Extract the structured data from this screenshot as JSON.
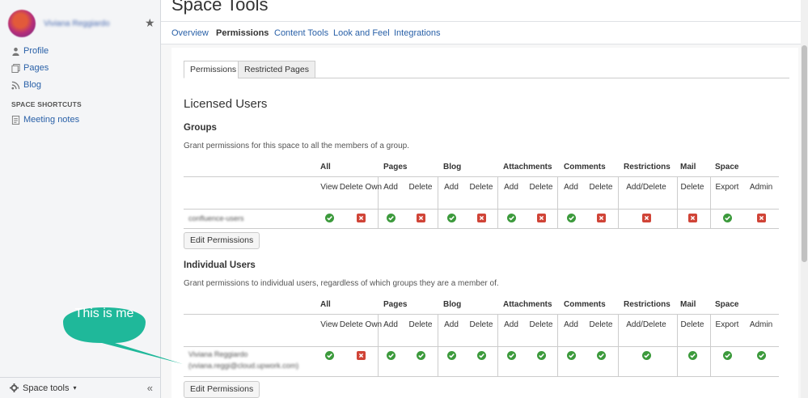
{
  "sidebar": {
    "user_name": "Viviana Reggiardo",
    "items": [
      {
        "label": "Profile",
        "icon": "person-icon"
      },
      {
        "label": "Pages",
        "icon": "pages-icon"
      },
      {
        "label": "Blog",
        "icon": "rss-icon"
      }
    ],
    "shortcuts_title": "SPACE SHORTCUTS",
    "shortcuts": [
      {
        "label": "Meeting notes",
        "icon": "document-icon"
      }
    ],
    "footer_label": "Space tools",
    "collapse_glyph": "«"
  },
  "header": {
    "title": "Space Tools",
    "tabs": [
      "Overview",
      "Permissions",
      "Content Tools",
      "Look and Feel",
      "Integrations"
    ],
    "active_tab": "Permissions"
  },
  "subtabs": [
    "Permissions",
    "Restricted Pages"
  ],
  "licensed_users_heading": "Licensed Users",
  "groups": {
    "heading": "Groups",
    "description": "Grant permissions for this space to all the members of a group.",
    "categories": [
      "All",
      "Pages",
      "Blog",
      "Attachments",
      "Comments",
      "Restrictions",
      "Mail",
      "Space"
    ],
    "columns": [
      "View",
      "Delete Own",
      "Add",
      "Delete",
      "Add",
      "Delete",
      "Add",
      "Delete",
      "Add",
      "Delete",
      "Add/Delete",
      "Delete",
      "Export",
      "Admin"
    ],
    "rows": [
      {
        "name": "confluence-users",
        "email": "",
        "perms": [
          true,
          false,
          true,
          false,
          true,
          false,
          true,
          false,
          true,
          false,
          false,
          false,
          true,
          false
        ]
      }
    ],
    "edit_button": "Edit Permissions"
  },
  "individual": {
    "heading": "Individual Users",
    "description": "Grant permissions to individual users, regardless of which groups they are a member of.",
    "categories": [
      "All",
      "Pages",
      "Blog",
      "Attachments",
      "Comments",
      "Restrictions",
      "Mail",
      "Space"
    ],
    "columns": [
      "View",
      "Delete Own",
      "Add",
      "Delete",
      "Add",
      "Delete",
      "Add",
      "Delete",
      "Add",
      "Delete",
      "Add/Delete",
      "Delete",
      "Export",
      "Admin"
    ],
    "rows": [
      {
        "name": "Viviana Reggiardo",
        "email": "(vviana.reggi@cloud.upwork.com)",
        "perms": [
          true,
          false,
          true,
          true,
          true,
          true,
          true,
          true,
          true,
          true,
          true,
          true,
          true,
          true
        ]
      }
    ],
    "edit_button": "Edit Permissions"
  },
  "callout": {
    "text": "This is me",
    "color": "#1fb89a"
  },
  "colors": {
    "link": "#2a61a8",
    "granted": "#3c9a3c",
    "denied": "#d04437"
  }
}
